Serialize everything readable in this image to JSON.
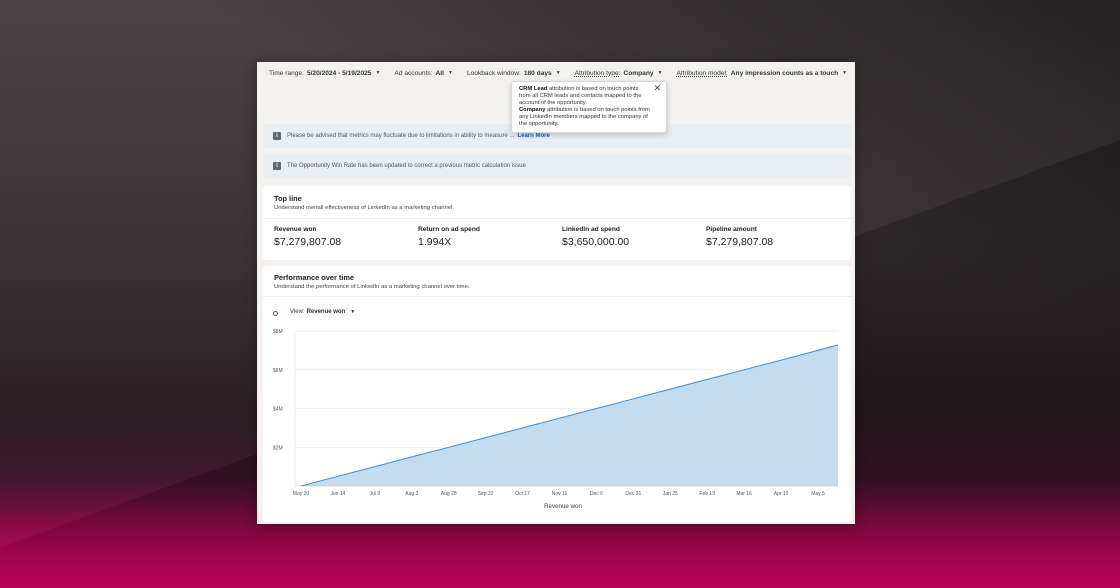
{
  "filters": {
    "time_range": {
      "label": "Time range:",
      "value": "5/20/2024 - 5/19/2025"
    },
    "ad_accounts": {
      "label": "Ad accounts:",
      "value": "All"
    },
    "lookback": {
      "label": "Lookback window:",
      "value": "180 days"
    },
    "attribution_type": {
      "label": "Attribution type:",
      "value": "Company"
    },
    "attribution_model": {
      "label": "Attribution model:",
      "value": "Any impression counts as a touch"
    }
  },
  "tooltip": {
    "crm_bold": "CRM Lead",
    "crm_text": " attribution is based on touch points from all CRM leads and contacts mapped to the account of the opportunity.",
    "company_bold": "Company",
    "company_text": " attribution is based on touch points from any LinkedIn members mapped to the company of the opportunity."
  },
  "notices": {
    "first": "Please be advised that metrics may fluctuate due to limitations in ability to measure ...",
    "first_link": "Learn More",
    "second": "The Opportunity Win Rate has been updated to correct a previous metric calculation issue"
  },
  "top_line": {
    "title": "Top line",
    "subtitle": "Understand overall effectiveness of LinkedIn as a marketing channel.",
    "metrics": [
      {
        "label": "Revenue won",
        "value": "$7,279,807.08"
      },
      {
        "label": "Return on ad spend",
        "value": "1.994X"
      },
      {
        "label": "LinkedIn ad spend",
        "value": "$3,650,000.00"
      },
      {
        "label": "Pipeline amount",
        "value": "$7,279,807.08"
      }
    ]
  },
  "performance": {
    "title": "Performance over time",
    "subtitle": "Understand the performance of LinkedIn as a marketing channel over time.",
    "view_label": "View:",
    "view_value": "Revenue won"
  },
  "colors": {
    "area_fill": "#c3dcef",
    "area_line": "#3b8ed0",
    "link": "#0a66c2"
  },
  "chart_data": {
    "type": "area",
    "x": [
      "May 20",
      "Jun 14",
      "Jul 9",
      "Aug 3",
      "Aug 28",
      "Sep 22",
      "Oct 17",
      "Nov 11",
      "Dec 6",
      "Dec 31",
      "Jan 25",
      "Feb 19",
      "Mar 16",
      "Apr 10",
      "May 5"
    ],
    "series": [
      {
        "name": "Revenue won",
        "values": [
          0,
          0.5,
          1.0,
          1.5,
          2.0,
          2.5,
          3.0,
          3.5,
          4.0,
          4.5,
          5.0,
          5.5,
          6.0,
          6.5,
          7.0
        ]
      }
    ],
    "end_value": 7.28,
    "y_ticks": [
      "$2M",
      "$4M",
      "$6M",
      "$8M"
    ],
    "ylim": [
      0,
      8
    ],
    "xlabel": "Revenue won",
    "ylabel": "",
    "grid": true
  }
}
